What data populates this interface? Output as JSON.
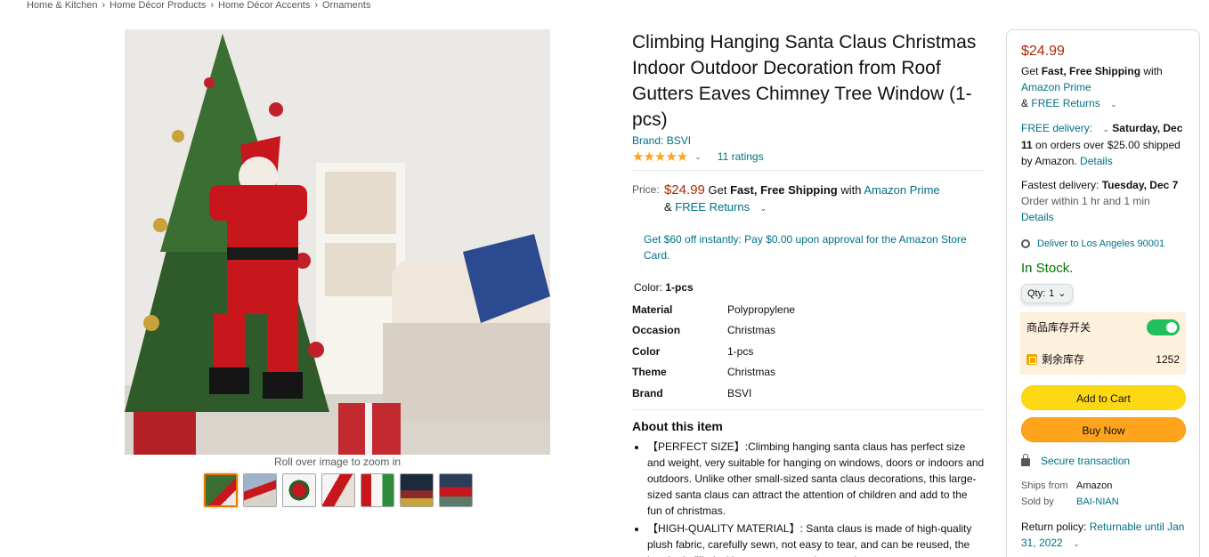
{
  "breadcrumb": [
    "Home & Kitchen",
    "Home Décor Products",
    "Home Décor Accents",
    "Ornaments"
  ],
  "gallery": {
    "zoom_hint": "Roll over image to zoom in",
    "thumb_count": 7
  },
  "product": {
    "title": "Climbing Hanging Santa Claus Christmas Indoor Outdoor Decoration from Roof Gutters Eaves Chimney Tree Window (1-pcs)",
    "brand": "Brand: BSVI",
    "stars": "★★★★★",
    "ratings": "11 ratings",
    "price_label": "Price:",
    "price": "$24.99",
    "get": "Get",
    "fast_free": "Fast, Free Shipping",
    "with": "with",
    "prime": "Amazon Prime",
    "amp": "&",
    "free_returns": "FREE Returns",
    "card_offer": "Get $60 off instantly: Pay $0.00 upon approval for the Amazon Store Card.",
    "color_label": "Color:",
    "color_value": "1-pcs",
    "specs": [
      {
        "key": "Material",
        "value": "Polypropylene"
      },
      {
        "key": "Occasion",
        "value": "Christmas"
      },
      {
        "key": "Color",
        "value": "1-pcs"
      },
      {
        "key": "Theme",
        "value": "Christmas"
      },
      {
        "key": "Brand",
        "value": "BSVI"
      }
    ],
    "about_heading": "About this item",
    "bullets": [
      "【PERFECT SIZE】:Climbing hanging santa claus has perfect size and weight, very suitable for hanging on windows, doors or indoors and outdoors. Unlike other small-sized santa claus decorations, this large-sized santa claus can attract the attention of children and add to the fun of christmas.",
      "【HIGH-QUALITY MATERIAL】: Santa claus is made of high-quality plush fabric, carefully sewn, not easy to tear, and can be reused, the interior is filled with pp cotton to make santa's"
    ]
  },
  "buybox": {
    "price": "$24.99",
    "get": "Get",
    "fast_free": "Fast, Free Shipping",
    "with": "with",
    "prime": "Amazon Prime",
    "amp": "&",
    "free_returns": "FREE Returns",
    "free_delivery": "FREE delivery:",
    "delivery_date": "Saturday, Dec 11",
    "delivery_rest": "on orders over $25.00 shipped by Amazon.",
    "details": "Details",
    "fastest_label": "Fastest delivery:",
    "fastest_date": "Tuesday, Dec 7",
    "order_within": "Order within 1 hr and 1 min",
    "details2": "Details",
    "deliver_to": "Deliver to Los Angeles 90001",
    "in_stock": "In Stock.",
    "qty_label": "Qty:",
    "qty_value": "1",
    "stock_switch_label": "商品库存开关",
    "stock_remaining_label": "剩余库存",
    "stock_remaining_value": "1252",
    "add_to_cart": "Add to Cart",
    "buy_now": "Buy Now",
    "secure": "Secure transaction",
    "ships_from_label": "Ships from",
    "ships_from_value": "Amazon",
    "sold_by_label": "Sold by",
    "sold_by_value": "BAI-NIAN",
    "return_label": "Return policy:",
    "return_value": "Returnable until Jan 31, 2022"
  },
  "colors": {
    "link": "#007185",
    "price": "#b12704",
    "in_stock": "#007600",
    "cart_button": "#ffd814",
    "buy_button": "#ffa41c",
    "star": "#ffa41c"
  }
}
